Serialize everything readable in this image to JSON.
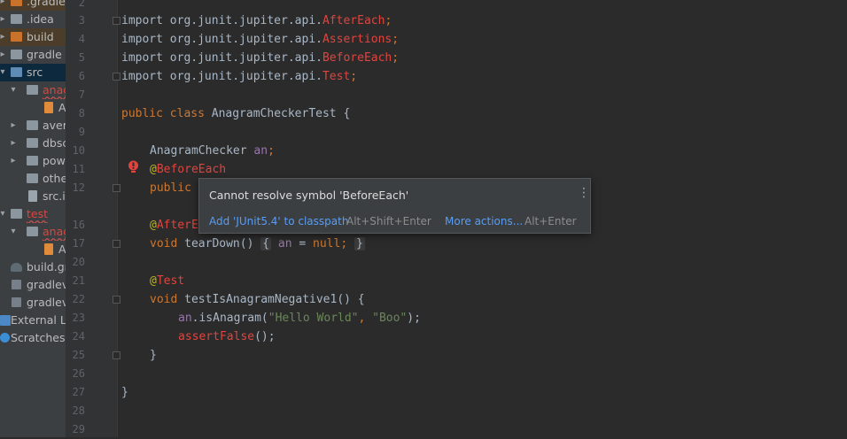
{
  "project_tree": {
    "items": [
      {
        "label": ".gradle",
        "icon": "folder-orange-icon"
      },
      {
        "label": ".idea",
        "icon": "folder-icon"
      },
      {
        "label": "build",
        "icon": "folder-orange-icon"
      },
      {
        "label": "gradle",
        "icon": "folder-icon"
      },
      {
        "label": "src",
        "icon": "folder-icon"
      },
      {
        "label": "anag",
        "icon": "folder-icon"
      },
      {
        "label": "A",
        "icon": "java-file-icon"
      },
      {
        "label": "aver",
        "icon": "folder-icon"
      },
      {
        "label": "dbsc",
        "icon": "folder-icon"
      },
      {
        "label": "pow",
        "icon": "folder-icon"
      },
      {
        "label": "othe",
        "icon": "folder-icon"
      },
      {
        "label": "src.ir",
        "icon": "folder-icon"
      },
      {
        "label": "test",
        "icon": "folder-icon"
      },
      {
        "label": "anag",
        "icon": "folder-icon"
      },
      {
        "label": "A",
        "icon": "java-file-icon"
      },
      {
        "label": "build.gr",
        "icon": "gradle-file-icon"
      },
      {
        "label": "gradlev",
        "icon": "script-file-icon"
      },
      {
        "label": "gradlev",
        "icon": "script-file-icon"
      },
      {
        "label": "External Li",
        "icon": "external-libraries-icon"
      },
      {
        "label": "Scratches a",
        "icon": "scratches-icon"
      }
    ]
  },
  "editor": {
    "line_numbers": [
      "2",
      "3",
      "4",
      "5",
      "6",
      "7",
      "8",
      "9",
      "10",
      "11",
      "12",
      "16",
      "17",
      "20",
      "21",
      "22",
      "23",
      "24",
      "25",
      "26",
      "27",
      "28",
      "29"
    ],
    "lines": {
      "l3_a": "import org.junit.jupiter.api.",
      "l3_b": "AfterEach",
      "l3_c": ";",
      "l4_a": "import org.junit.jupiter.api.",
      "l4_b": "Assertions",
      "l4_c": ";",
      "l5_a": "import org.junit.jupiter.api.",
      "l5_b": "BeforeEach",
      "l5_c": ";",
      "l6_a": "import org.junit.jupiter.api.",
      "l6_b": "Test",
      "l6_c": ";",
      "l8_kw": "public class ",
      "l8_name": "AnagramCheckerTest {",
      "l10_type": "AnagramChecker ",
      "l10_field": "an",
      "l10_end": ";",
      "l11_at": "@",
      "l11_ann": "BeforeEach",
      "l12_kw": "public",
      "l16_at": "@",
      "l16_ann": "AfterE",
      "l17_kw": "void ",
      "l17_name": "tearDown() ",
      "l17_b1": "{",
      "l17_field": " an",
      "l17_mid": " = ",
      "l17_null": "null",
      "l17_semi": "; ",
      "l17_b2": "}",
      "l21_at": "@",
      "l21_ann": "Test",
      "l22_kw": "void ",
      "l22_rest": "testIsAnagramNegative1() {",
      "l23_field": "an",
      "l23_call": ".isAnagram(",
      "l23_s1": "\"Hello World\"",
      "l23_comma": ", ",
      "l23_s2": "\"Boo\"",
      "l23_end": ");",
      "l24_call": "assertFalse",
      "l24_end": "();",
      "l25_brace": "}",
      "l27_brace": "}"
    }
  },
  "popup": {
    "message": "Cannot resolve symbol 'BeforeEach'",
    "menu_icon": "⋮",
    "action_label": "Add 'JUnit5.4' to classpath",
    "action_shortcut": "Alt+Shift+Enter",
    "more_label": "More actions...",
    "more_shortcut": "Alt+Enter"
  },
  "colors": {
    "keyword": "#cc7832",
    "unresolved": "#e0443e",
    "string": "#6a8759",
    "field": "#9876aa",
    "link": "#589df6"
  }
}
